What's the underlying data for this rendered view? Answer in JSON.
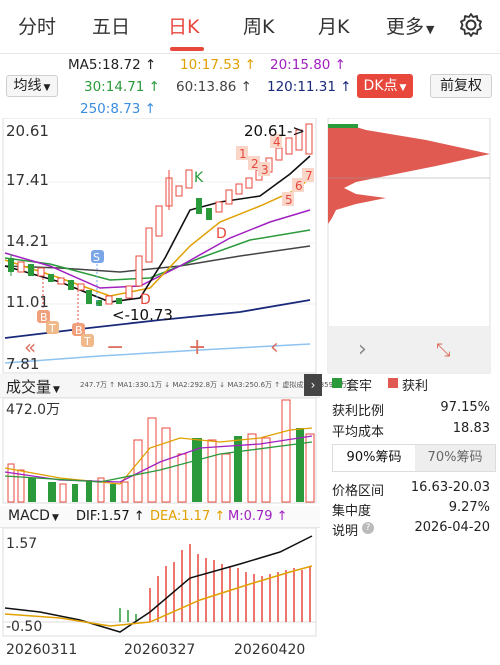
{
  "tabs": [
    "分时",
    "五日",
    "日K",
    "周K",
    "月K",
    "更多"
  ],
  "active_tab": "日K",
  "ma": {
    "ma5": "MA5:18.72 ↑",
    "ma10": "10:17.53 ↑",
    "ma20": "20:15.80 ↑",
    "ma30": "30:14.71 ↑",
    "ma60": "60:13.86 ↑",
    "ma120": "120:11.31 ↑",
    "ma250": "250:8.73 ↑"
  },
  "toolbar": {
    "ma_select": "均线",
    "dk_button": "DK点",
    "fq_button": "前复权"
  },
  "price_axis": {
    "top": "20.61",
    "p2": "17.41",
    "p3": "14.21",
    "p4": "11.01",
    "bottom": "7.81"
  },
  "price_annotations": {
    "high": "20.61->",
    "low": "<-10.73",
    "k_marker": "K",
    "d_marker1": "D",
    "d_marker2": "D",
    "s_marker": "S",
    "b_marker1": "B",
    "b_marker2": "B",
    "t_marker1": "T",
    "t_marker2": "T",
    "seq_up": [
      "1",
      "2",
      "3",
      "4"
    ],
    "seq_down": [
      "5",
      "6",
      "7"
    ]
  },
  "chip_panel": {
    "legend_trapped": "套牢",
    "legend_profit": "获利",
    "profit_ratio_label": "获利比例",
    "profit_ratio": "97.15%",
    "avg_cost_label": "平均成本",
    "avg_cost": "18.83",
    "tab_90": "90%筹码",
    "tab_70": "70%筹码",
    "price_range_label": "价格区间",
    "price_range": "16.63-20.03",
    "concentration_label": "集中度",
    "concentration": "9.27%",
    "note_label": "说明",
    "note_date": "2026-04-20"
  },
  "volume": {
    "title": "成交量",
    "legend": "247.7万 ↑ MA1:330.1万 ↓ MA2:292.8万 ↓ MA3:250.6万 ↑ 虚拟成交量:359.4万",
    "axis_top": "472.0万"
  },
  "macd": {
    "title": "MACD",
    "dif": "DIF:1.57 ↑",
    "dea": "DEA:1.17 ↑",
    "m": "M:0.79 ↑",
    "axis_top": "1.57",
    "axis_bottom": "-0.50"
  },
  "dates": [
    "20260311",
    "20260327",
    "20260420"
  ],
  "colors": {
    "up": "#e8473c",
    "down": "#2a9a3a",
    "accent": "#e8473c"
  }
}
